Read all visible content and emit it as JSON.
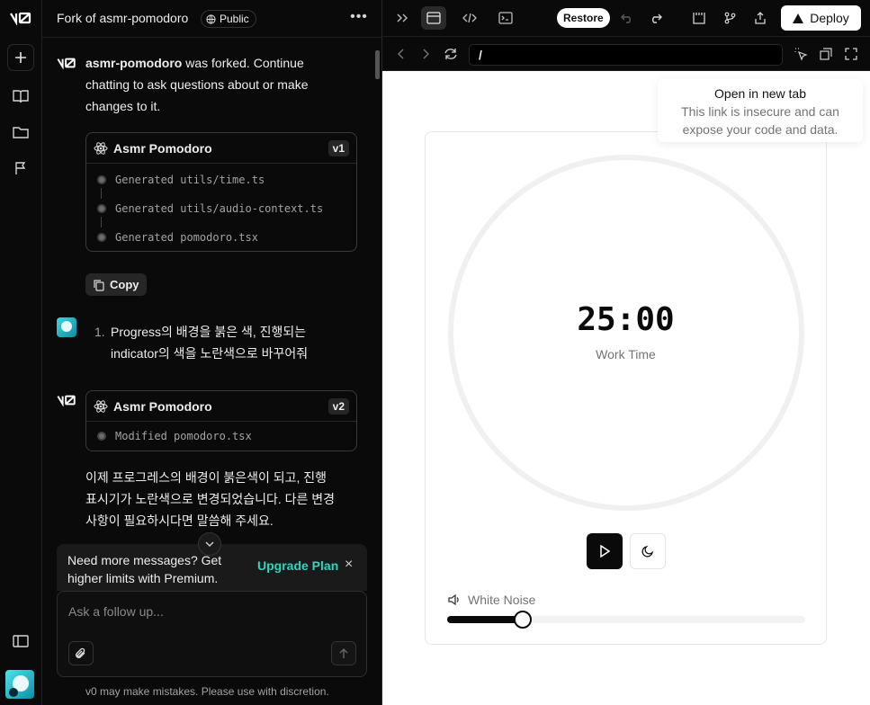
{
  "header": {
    "title": "Fork of asmr-pomodoro",
    "visibility": "Public"
  },
  "chat": {
    "fork_message": {
      "project": "asmr-pomodoro",
      "text": " was forked. Continue chatting to ask questions about or make changes to it."
    },
    "card_v1": {
      "name": "Asmr Pomodoro",
      "version": "v1",
      "steps": [
        "Generated utils/time.ts",
        "Generated utils/audio-context.ts",
        "Generated pomodoro.tsx"
      ]
    },
    "copy_label": "Copy",
    "user_message": {
      "number": "1.",
      "line1": "Progress의 배경을 붉은 색, 진행되는",
      "line2": "indicator의 색을 노란색으로 바꾸어줘"
    },
    "card_v2": {
      "name": "Asmr Pomodoro",
      "version": "v2",
      "steps": [
        "Modified pomodoro.tsx"
      ]
    },
    "assistant_reply": {
      "line1": "이제 프로그레스의 배경이 붉은색이 되고, 진행",
      "line2": "표시기가 노란색으로 변경되었습니다. 다른 변경",
      "line3": "사항이 필요하시다면 말씀해 주세요."
    },
    "upgrade": {
      "line1": "Need more messages? Get",
      "line2": "higher limits with Premium.",
      "link": "Upgrade Plan"
    },
    "input_placeholder": "Ask a follow up...",
    "disclaimer": "v0 may make mistakes. Please use with discretion."
  },
  "toolbar": {
    "restore_label": "Restore",
    "deploy_label": "Deploy"
  },
  "urlbar": {
    "path": "/"
  },
  "tooltip": {
    "title": "Open in new tab",
    "line1": "This link is insecure and can",
    "line2": "expose your code and data."
  },
  "app": {
    "time": "25:00",
    "mode": "Work Time",
    "noise_label": "White Noise",
    "volume": 0.21
  },
  "colors": {
    "accent": "#2dd4bf",
    "dark": "#000000"
  }
}
